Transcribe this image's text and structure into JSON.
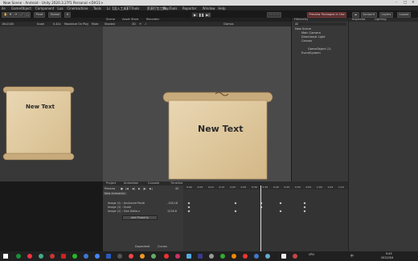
{
  "window": {
    "title": "New Scene - Android - Unity 2020.3.27f1 Personal <DX11>"
  },
  "menu": [
    "ile",
    "GameObject",
    "Component",
    "Lua",
    "Cinemachine",
    "Tools",
    "Lc【混入工具】",
    "ET-Tools",
    "资源打包工具",
    "MapTools",
    "Reporter",
    "Window",
    "Help"
  ],
  "toolbar": {
    "pivot": "Pivot",
    "global": "Global",
    "right_badge": "Preview Packages in Use",
    "account": "Account",
    "layers": "Layers",
    "layout": "Layout"
  },
  "tabs": {
    "scene": "Scene",
    "asset_store": "Asset Store",
    "recorder": "Recorder",
    "hierarchy": "Hierarchy",
    "inspector": "Inspector",
    "lighting": "Lighting",
    "project": "Project",
    "animation": "Animation",
    "console": "Console",
    "timeline": "Timeline"
  },
  "game_bar": {
    "resolution": "16x2160",
    "scale_label": "Scale",
    "scale_value": "0.42x",
    "maximize": "Maximize On Play",
    "mute": "Mute"
  },
  "scene_bar": {
    "shading": "Shaded",
    "mode": "2D",
    "gizmos": "Gizmos"
  },
  "game_view": {
    "text": "New Text"
  },
  "scene_view": {
    "text": "New Text"
  },
  "hierarchy": {
    "search": "All",
    "scene_name": "New Scene",
    "items": [
      "Main Camera",
      "Directional Light",
      "Canvas",
      "",
      "GameObject (1)",
      "EventSystem"
    ]
  },
  "animation": {
    "preview": "Preview",
    "frame": "45",
    "clip": "New Animation",
    "properties": [
      {
        "name": "Image (1) : Anchored Positi",
        "value": "-128.18"
      },
      {
        "name": "Image (1) : Scale",
        "value": ""
      },
      {
        "name": "Image (1) : Size Delta.x",
        "value": "1218.6"
      }
    ],
    "add_property": "Add Property",
    "dopesheet": "Dopesheet",
    "curves": "Curves",
    "ruler": [
      "0:00",
      "0:05",
      "0:10",
      "0:15",
      "0:20",
      "0:25",
      "0:30",
      "0:35",
      "0:40",
      "0:45",
      "0:50",
      "0:55",
      "1:00",
      "1:05",
      "1:10"
    ]
  },
  "taskbar": {
    "time": "9:45",
    "date": "2022/3/4",
    "lang": "中"
  }
}
